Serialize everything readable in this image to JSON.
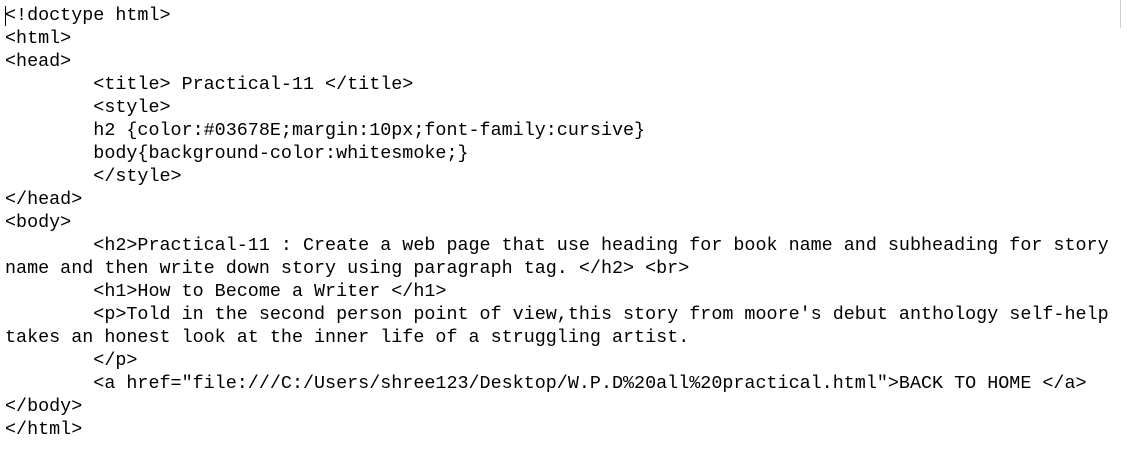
{
  "editor": {
    "lines": [
      "<!doctype html>",
      "<html>",
      "<head>",
      "        <title> Practical-11 </title>",
      "        <style>",
      "        h2 {color:#03678E;margin:10px;font-family:cursive}",
      "        body{background-color:whitesmoke;}",
      "        </style>",
      "</head>",
      "<body>",
      "        <h2>Practical-11 : Create a web page that use heading for book name and subheading for story",
      "name and then write down story using paragraph tag. </h2> <br>",
      "        <h1>How to Become a Writer </h1>",
      "        <p>Told in the second person point of view,this story from moore's debut anthology self-help",
      "takes an honest look at the inner life of a struggling artist.",
      "        </p>",
      "        <a href=\"file:///C:/Users/shree123/Desktop/W.P.D%20all%20practical.html\">BACK TO HOME </a>",
      "</body>",
      "</html>"
    ]
  }
}
